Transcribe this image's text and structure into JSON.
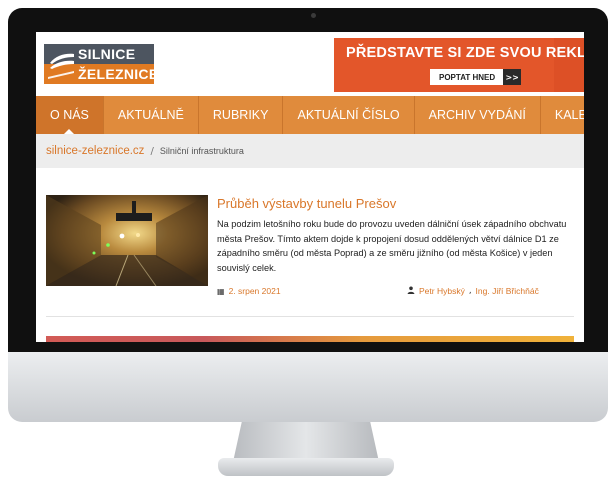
{
  "logo": {
    "line1": "SILNICE",
    "line2": "ŽELEZNICE"
  },
  "banner": {
    "text": "PŘEDSTAVTE SI ZDE SVOU REKLAMU",
    "cta": "POPTAT HNED",
    "cta_arrow": ">>"
  },
  "nav": {
    "items": [
      {
        "label": "O NÁS"
      },
      {
        "label": "AKTUÁLNĚ"
      },
      {
        "label": "RUBRIKY"
      },
      {
        "label": "AKTUÁLNÍ ČÍSLO"
      },
      {
        "label": "ARCHIV VYDÁNÍ"
      },
      {
        "label": "KALENDÁŘ"
      }
    ]
  },
  "breadcrumb": {
    "home": "silnice-zeleznice.cz",
    "separator": "/",
    "current": "Silniční infrastruktura"
  },
  "article": {
    "title": "Průběh výstavby tunelu Prešov",
    "excerpt": "Na podzim letošního roku bude do provozu uveden dálniční úsek západního obchvatu města Prešov. Tímto aktem dojde k propojení dosud oddělených větví dálnice D1 ze západního směru (od města Poprad) a ze směru jižního (od města Košice) v jeden souvislý celek.",
    "date": "2. srpen 2021",
    "authors": [
      "Petr Hybský",
      "Ing. Jiří Břichňáč"
    ],
    "author_separator": ","
  },
  "icons": {
    "date": "calendar-icon",
    "author": "person-icon"
  },
  "colors": {
    "accent": "#d9772a",
    "nav": "#e08b3c",
    "banner": "#e3562a",
    "logo_dark": "#4d5560"
  }
}
